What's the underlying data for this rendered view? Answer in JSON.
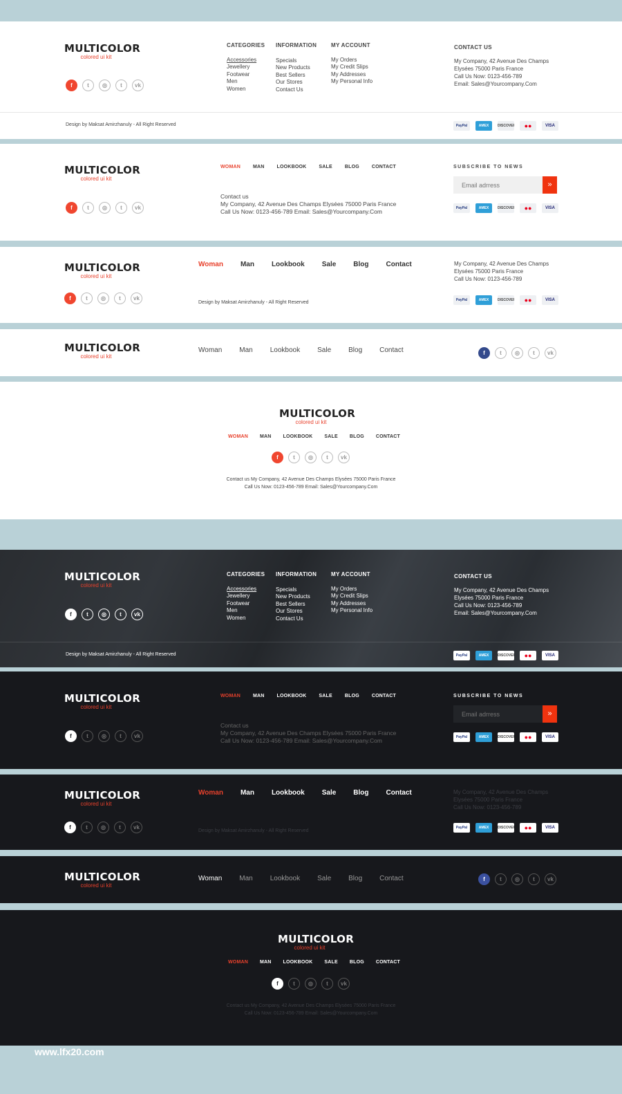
{
  "logo": {
    "word": "MULTICOLOR",
    "tagline": "colored ui kit"
  },
  "social_icons": [
    "facebook-icon",
    "twitter-icon",
    "instagram-icon",
    "tumblr-icon",
    "vk-icon"
  ],
  "social_glyphs": {
    "facebook": "f",
    "twitter": "t",
    "instagram": "◎",
    "tumblr": "t",
    "vk": "vk"
  },
  "columns": {
    "categories": {
      "title": "CATEGORIES",
      "items": [
        "Accessories",
        "Jewellery",
        "Footwear",
        "Men",
        "Women"
      ]
    },
    "information": {
      "title": "INFORMATION",
      "items": [
        "Specials",
        "New Products",
        "Best Sellers",
        "Our Stores",
        "Contact Us"
      ]
    },
    "account": {
      "title": "MY ACCOUNT",
      "items": [
        "My Orders",
        "My Credit Slips",
        "My Addresses",
        "My Personal Info"
      ]
    }
  },
  "contact": {
    "title": "CONTACT US",
    "lines": [
      "My Company, 42 Avenue Des Champs",
      "Elysées 75000 Paris France",
      "Call Us Now: 0123-456-789",
      "Email: Sales@Yourcompany.Com"
    ]
  },
  "copyright": "Design by Maksat Amirzhanuly - All Right Reserved",
  "payment_cards": [
    "PayPal",
    "AMEX",
    "DISCOVER",
    "●●",
    "VISA"
  ],
  "nav_upper": [
    "WOMAN",
    "MAN",
    "LOOKBOOK",
    "SALE",
    "BLOG",
    "CONTACT"
  ],
  "nav_title": [
    "Woman",
    "Man",
    "Lookbook",
    "Sale",
    "Blog",
    "Contact"
  ],
  "subscribe": {
    "title": "SUBSCRIBE TO NEWS",
    "placeholder": "Email adrress",
    "button": "»"
  },
  "contact_block": {
    "heading": "Contact us",
    "line1": "My Company, 42 Avenue Des Champs Elysées 75000 Paris France",
    "line2": "Call Us Now: 0123-456-789 Email: Sales@Yourcompany.Com"
  },
  "contact_short": [
    "My Company, 42 Avenue Des Champs",
    "Elysées 75000 Paris France",
    "Call Us Now: 0123-456-789"
  ],
  "center_contact": {
    "line1": "Contact us My Company, 42 Avenue Des Champs Elysées 75000 Paris France",
    "line2": "Call Us Now: 0123-456-789 Email: Sales@Yourcompany.Com"
  },
  "watermark": "www.lfx20.com",
  "colors": {
    "accent": "#e8412c",
    "facebook_blue": "#344a8c",
    "page_bg": "#b9d1d7",
    "dark_bg": "#17181c"
  }
}
